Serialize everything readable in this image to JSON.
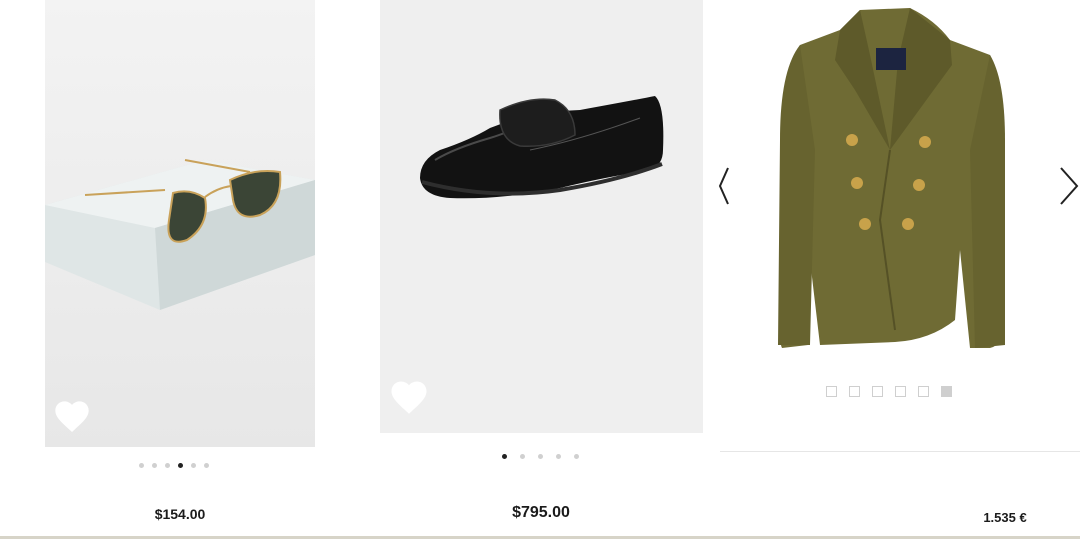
{
  "products": [
    {
      "name_icon": "sunglasses-icon",
      "price": "$154.00",
      "image_dots": {
        "count": 6,
        "active_index": 3
      },
      "favorite": false
    },
    {
      "name_icon": "loafer-icon",
      "price": "$795.00",
      "image_dots": {
        "count": 5,
        "active_index": 0
      },
      "favorite": false
    },
    {
      "name_icon": "blazer-icon",
      "price": "1.535 €",
      "image_dots": {
        "count": 6,
        "active_index": 5,
        "shape": "square"
      },
      "favorite": false
    }
  ],
  "colors": {
    "background": "#ffffff",
    "price_text": "#1b1b1b",
    "dot_active": "#222222",
    "dot_inactive": "#d0d0d0",
    "blazer": "#6e6a32",
    "button_gold": "#c8a24a"
  }
}
